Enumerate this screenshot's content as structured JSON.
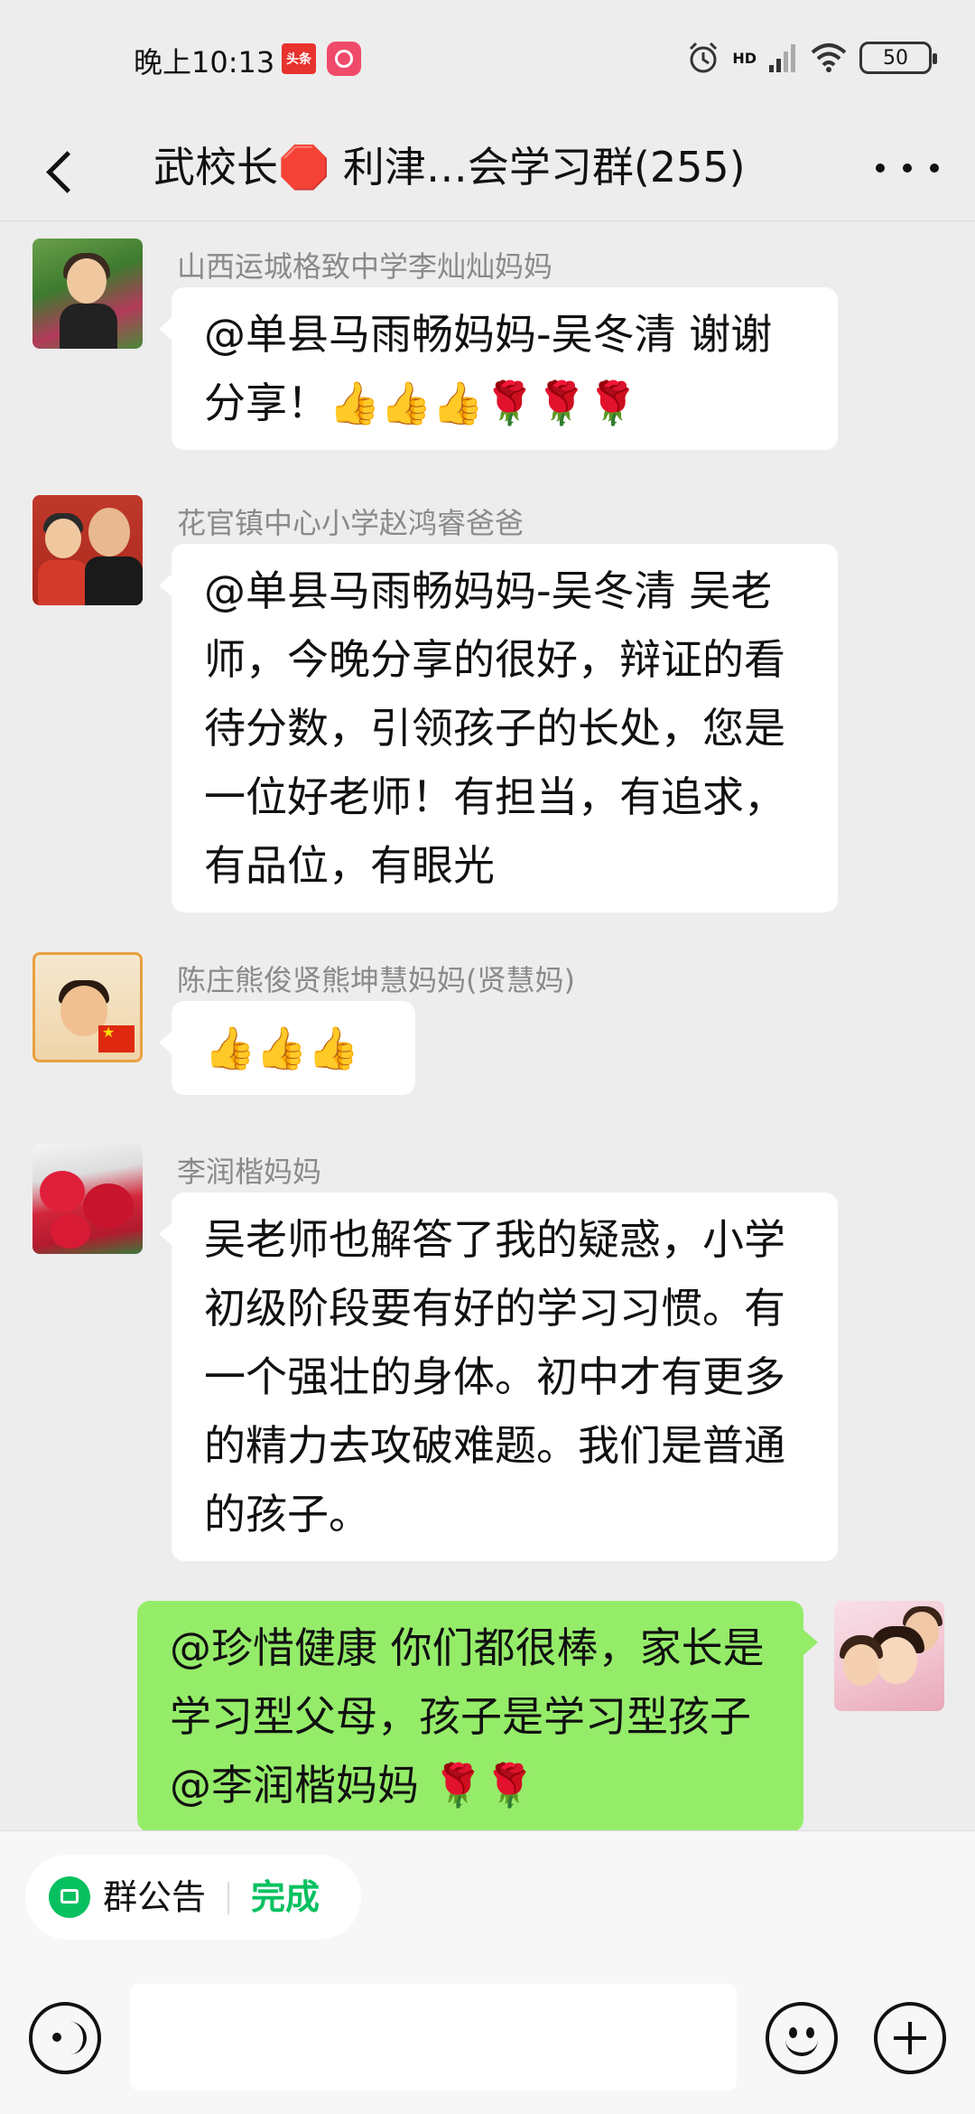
{
  "status_bar": {
    "time": "晚上10:13",
    "app_icon_1_text": "头条",
    "network": "HD",
    "battery": "50"
  },
  "header": {
    "title": "武校长🛑 利津…会学习群(255)"
  },
  "messages": [
    {
      "sender": "山西运城格致中学李灿灿妈妈",
      "text": "@单县马雨畅妈妈-吴冬清  谢谢分享！👍👍👍🌹🌹🌹"
    },
    {
      "sender": "花官镇中心小学赵鸿睿爸爸",
      "text": "@单县马雨畅妈妈-吴冬清  吴老师，今晚分享的很好，辩证的看待分数，引领孩子的长处，您是一位好老师！有担当，有追求，有品位，有眼光"
    },
    {
      "sender": "陈庄熊俊贤熊坤慧妈妈(贤慧妈)",
      "text": "👍👍👍"
    },
    {
      "sender": "李润楷妈妈",
      "text": "吴老师也解答了我的疑惑，小学初级阶段要有好的学习习惯。有一个强壮的身体。初中才有更多的精力去攻破难题。我们是普通的孩子。"
    },
    {
      "sender": "",
      "text": "@珍惜健康  你们都很棒，家长是学习型父母，孩子是学习型孩子@李润楷妈妈 🌹🌹"
    }
  ],
  "bottom": {
    "notice_label": "群公告",
    "done_label": "完成",
    "input_value": ""
  },
  "colors": {
    "background": "#ededed",
    "my_bubble": "#95ec69",
    "accent": "#07c160"
  },
  "icons": [
    "back-arrow-icon",
    "more-dots-icon",
    "announcement-icon",
    "voice-icon",
    "emoji-icon",
    "plus-icon",
    "wifi-icon",
    "signal-icon",
    "alarm-icon",
    "battery-icon"
  ]
}
